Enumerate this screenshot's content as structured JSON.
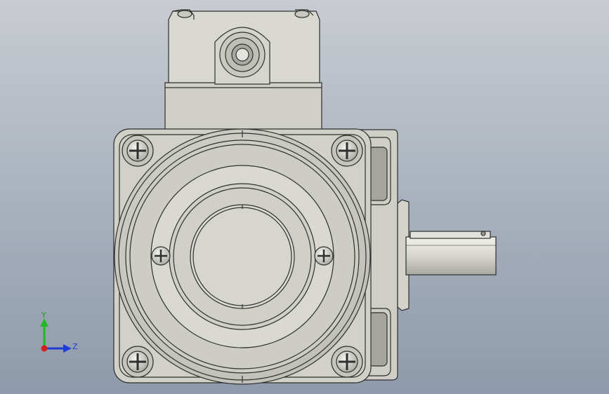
{
  "viewport": {
    "background_top": "#c8ccd1",
    "background_bottom": "#8e9aab",
    "model_color": "#d3d3cc",
    "edge_color": "#2f2f2f"
  },
  "triad": {
    "y_label": "Y",
    "z_label": "Z",
    "y_color": "#28b428",
    "z_color": "#1f3dd6",
    "x_color": "#d61f1f"
  }
}
